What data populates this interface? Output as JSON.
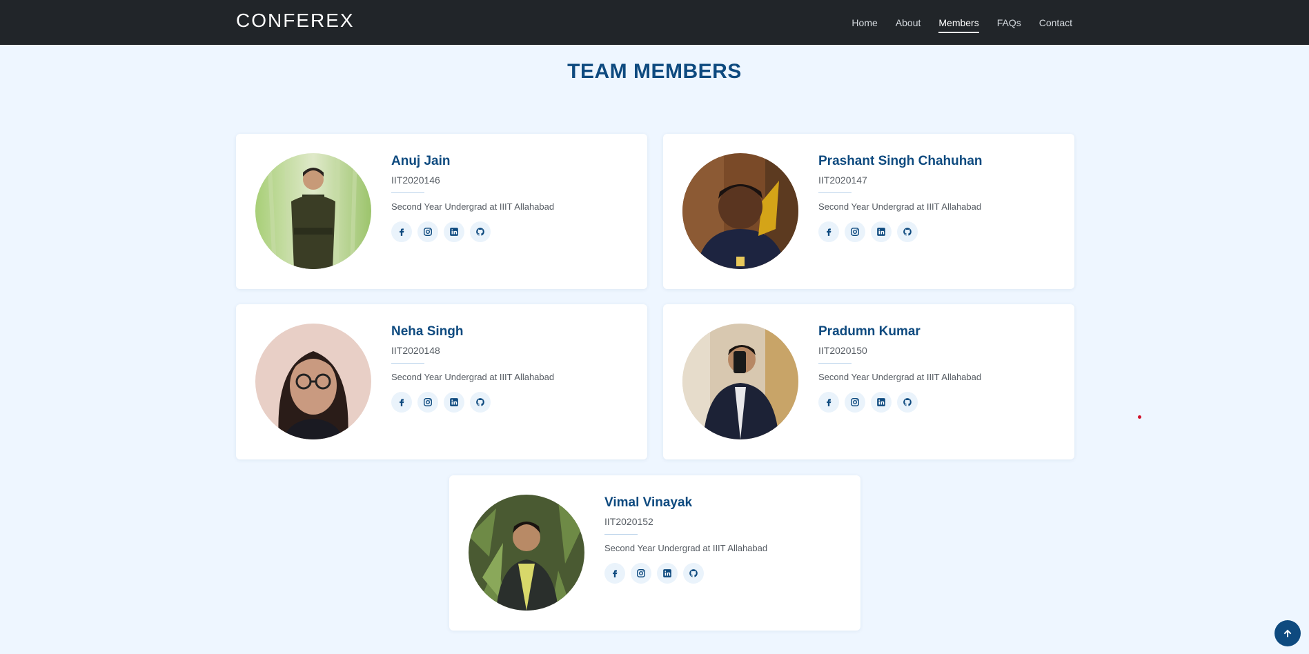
{
  "header": {
    "brand": "CONFEREX",
    "nav": [
      "Home",
      "About",
      "Members",
      "FAQs",
      "Contact"
    ],
    "active": "Members"
  },
  "page_title": "TEAM MEMBERS",
  "members": [
    {
      "name": "Anuj Jain",
      "id": "IIT2020146",
      "description": "Second Year Undergrad at IIIT Allahabad"
    },
    {
      "name": "Prashant Singh Chahuhan",
      "id": "IIT2020147",
      "description": "Second Year Undergrad at IIIT Allahabad"
    },
    {
      "name": "Neha Singh",
      "id": "IIT2020148",
      "description": "Second Year Undergrad at IIIT Allahabad"
    },
    {
      "name": "Pradumn Kumar",
      "id": "IIT2020150",
      "description": "Second Year Undergrad at IIIT Allahabad"
    },
    {
      "name": "Vimal Vinayak",
      "id": "IIT2020152",
      "description": "Second Year Undergrad at IIIT Allahabad"
    }
  ],
  "social_icons": [
    "facebook-icon",
    "instagram-icon",
    "linkedin-icon",
    "github-icon"
  ],
  "colors": {
    "navbar": "#212529",
    "background": "#eef6ff",
    "accent": "#0e4a7f",
    "icon_bg": "#eaf3fb"
  }
}
